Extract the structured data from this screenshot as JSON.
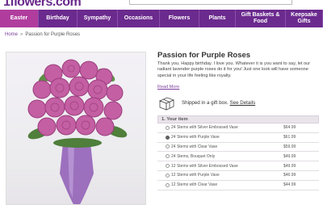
{
  "header": {
    "logo_text": "1flowers.com"
  },
  "nav": {
    "items": [
      {
        "label": "Easter",
        "active": true
      },
      {
        "label": "Birthday"
      },
      {
        "label": "Sympathy"
      },
      {
        "label": "Occasions"
      },
      {
        "label": "Flowers"
      },
      {
        "label": "Plants"
      },
      {
        "label": "Gift Baskets & Food"
      },
      {
        "label": "Keepsake Gifts"
      }
    ]
  },
  "breadcrumb": {
    "home": "Home",
    "separator": "»",
    "current": "Passion for Purple Roses"
  },
  "product": {
    "title": "Passion for Purple Roses",
    "description": "Thank you. Happy birthday. I love you. Whatever it is you want to say, let our radiant lavender purple roses do it for you! Just one look will have someone special in your life feeling like royalty.",
    "read_more": "Read More",
    "shipping_text": "Shipped in a gift box.",
    "shipping_link": "See Details",
    "section_label": "1. Your item",
    "options": [
      {
        "label": "24 Stems with Silver Embossed Vase",
        "price": "$64.99",
        "selected": false
      },
      {
        "label": "24 Stems with Purple Vase",
        "price": "$61.99",
        "selected": true
      },
      {
        "label": "24 Stems with Clear Vase",
        "price": "$59.99",
        "selected": false
      },
      {
        "label": "24 Stems, Bouquet Only",
        "price": "$49.99",
        "selected": false
      },
      {
        "label": "12 Stems with Silver Embossed Vase",
        "price": "$49.99",
        "selected": false
      },
      {
        "label": "12 Stems with Purple Vase",
        "price": "$46.99",
        "selected": false
      },
      {
        "label": "12 Stems with Clear Vase",
        "price": "$44.99",
        "selected": false
      }
    ]
  },
  "colors": {
    "nav_bg": "#6b2a8e",
    "nav_active": "#b03d9e",
    "link": "#7a3f9a"
  }
}
